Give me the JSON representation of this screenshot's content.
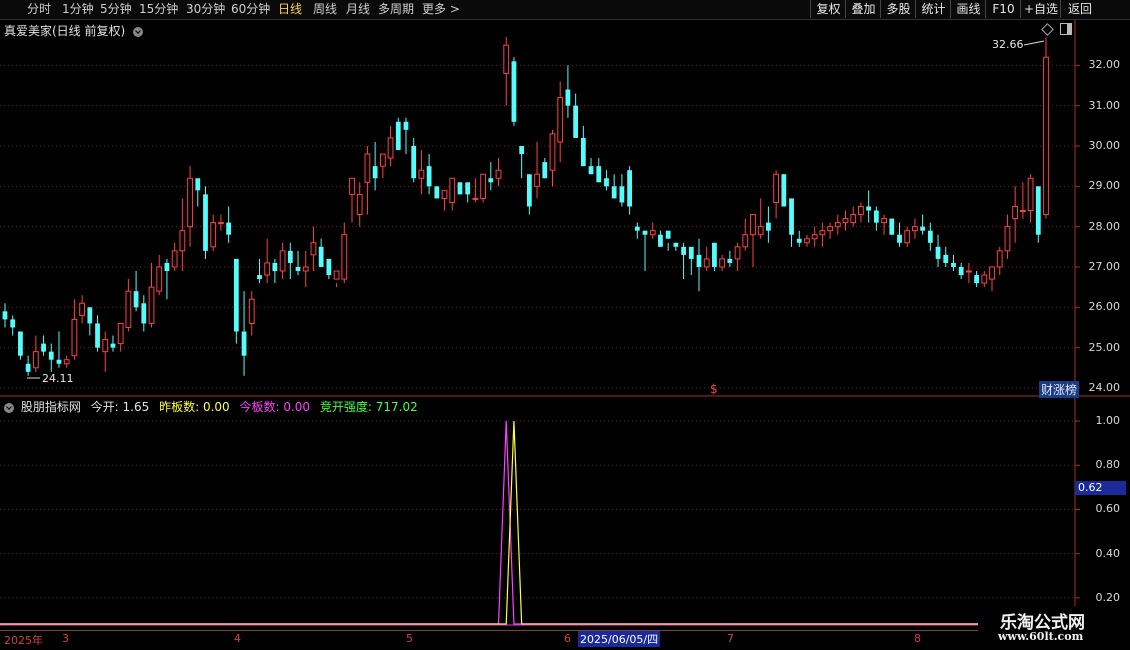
{
  "toolbar": {
    "periods": [
      "分时",
      "1分钟",
      "5分钟",
      "15分钟",
      "30分钟",
      "60分钟",
      "日线",
      "周线",
      "月线",
      "多周期",
      "更多 >"
    ],
    "active_period": "日线",
    "right_buttons": [
      "复权",
      "叠加",
      "多股",
      "统计",
      "画线",
      "F10",
      "+自选",
      "返回"
    ]
  },
  "main_panel": {
    "title": "真爱美家(日线 前复权)",
    "y_ticks": [
      "32.00",
      "31.00",
      "30.00",
      "29.00",
      "28.00",
      "27.00",
      "26.00",
      "25.00",
      "24.00"
    ],
    "high_label": "32.66",
    "low_label": "24.11",
    "board_label": "财涨榜",
    "dollar_marker": "$"
  },
  "indicator": {
    "name": "股朋指标网",
    "fields": [
      {
        "label": "今开: ",
        "value": "1.65"
      },
      {
        "label": "昨板数: ",
        "value": "0.00"
      },
      {
        "label": "今板数: ",
        "value": "0.00"
      },
      {
        "label": "竞开强度: ",
        "value": "717.02"
      }
    ],
    "y_ticks": [
      "1.00",
      "0.80",
      "0.60",
      "0.40",
      "0.20"
    ],
    "current_value": "0.62"
  },
  "date_axis": {
    "year_label": "2025年",
    "months": [
      "3",
      "4",
      "5",
      "6",
      "7",
      "8"
    ],
    "cursor_date": "2025/06/05/四"
  },
  "watermark": {
    "line1": "乐淘公式网",
    "line2": "www.60lt.com"
  },
  "colors": {
    "up": "#ff4040",
    "down": "#54fcfc",
    "background": "#000000",
    "yellow_line": "#ffff40",
    "magenta_line": "#ff40ff",
    "green_text": "#40ff40"
  },
  "chart_data": {
    "type": "candlestick",
    "y_range": [
      23.9,
      33.0
    ],
    "indicator_range": [
      0.1,
      1.05
    ],
    "ohlc": [
      [
        25.9,
        26.1,
        25.5,
        25.7
      ],
      [
        25.7,
        25.8,
        25.3,
        25.5
      ],
      [
        25.4,
        25.4,
        24.7,
        24.8
      ],
      [
        24.6,
        24.8,
        24.3,
        24.4
      ],
      [
        24.5,
        25.3,
        24.4,
        24.9
      ],
      [
        25.1,
        25.3,
        24.8,
        24.9
      ],
      [
        24.9,
        25.1,
        24.4,
        24.7
      ],
      [
        24.7,
        25.4,
        24.5,
        24.6
      ],
      [
        24.6,
        24.8,
        24.5,
        24.7
      ],
      [
        24.8,
        26.2,
        24.7,
        25.7
      ],
      [
        25.8,
        26.3,
        25.6,
        26.1
      ],
      [
        26.0,
        26.0,
        25.3,
        25.6
      ],
      [
        25.6,
        25.8,
        24.9,
        25.0
      ],
      [
        24.9,
        25.4,
        24.4,
        25.2
      ],
      [
        25.1,
        25.3,
        24.9,
        25.0
      ],
      [
        25.1,
        25.6,
        24.9,
        25.6
      ],
      [
        25.5,
        26.7,
        25.4,
        26.4
      ],
      [
        26.4,
        26.9,
        25.9,
        26.0
      ],
      [
        26.1,
        26.3,
        25.4,
        25.6
      ],
      [
        25.6,
        27.1,
        25.5,
        26.5
      ],
      [
        26.4,
        27.3,
        26.3,
        27.0
      ],
      [
        27.1,
        27.2,
        26.2,
        26.9
      ],
      [
        27.0,
        27.6,
        26.9,
        27.4
      ],
      [
        27.4,
        28.7,
        26.9,
        27.9
      ],
      [
        28.0,
        29.5,
        27.5,
        29.2
      ],
      [
        29.2,
        29.1,
        28.5,
        28.9
      ],
      [
        28.8,
        29.0,
        27.2,
        27.4
      ],
      [
        27.5,
        28.3,
        27.4,
        28.1
      ],
      [
        28.1,
        28.3,
        27.9,
        28.1
      ],
      [
        28.1,
        28.5,
        27.6,
        27.8
      ],
      [
        27.2,
        27.2,
        25.1,
        25.4
      ],
      [
        25.4,
        26.4,
        24.3,
        24.8
      ],
      [
        25.6,
        26.4,
        25.3,
        26.2
      ],
      [
        26.8,
        27.2,
        26.6,
        26.7
      ],
      [
        26.8,
        27.7,
        26.6,
        27.1
      ],
      [
        27.1,
        27.2,
        26.6,
        26.9
      ],
      [
        26.9,
        27.6,
        26.7,
        27.4
      ],
      [
        27.4,
        27.6,
        26.7,
        27.1
      ],
      [
        27.0,
        27.4,
        26.8,
        26.9
      ],
      [
        26.9,
        27.4,
        26.5,
        27.0
      ],
      [
        27.3,
        28.0,
        26.9,
        27.6
      ],
      [
        27.5,
        27.7,
        27.2,
        27.0
      ],
      [
        27.2,
        27.0,
        26.7,
        26.8
      ],
      [
        26.7,
        26.6,
        26.5,
        26.9
      ],
      [
        26.7,
        28.1,
        26.6,
        27.8
      ],
      [
        28.8,
        29.2,
        28.1,
        29.2
      ],
      [
        28.3,
        29.1,
        28.0,
        28.8
      ],
      [
        29.1,
        30.0,
        28.3,
        29.8
      ],
      [
        29.5,
        30.1,
        28.9,
        29.2
      ],
      [
        29.5,
        29.8,
        29.2,
        29.8
      ],
      [
        29.7,
        30.5,
        29.5,
        30.2
      ],
      [
        30.6,
        30.7,
        29.9,
        29.9
      ],
      [
        30.6,
        30.7,
        29.8,
        30.4
      ],
      [
        30.0,
        30.2,
        29.1,
        29.2
      ],
      [
        29.2,
        29.9,
        28.8,
        29.4
      ],
      [
        29.5,
        29.8,
        28.8,
        29.0
      ],
      [
        29.0,
        29.0,
        28.7,
        28.7
      ],
      [
        28.7,
        28.9,
        28.4,
        28.9
      ],
      [
        28.6,
        29.2,
        28.4,
        29.2
      ],
      [
        29.1,
        29.0,
        28.8,
        28.8
      ],
      [
        29.1,
        28.9,
        28.6,
        28.8
      ],
      [
        28.7,
        29.2,
        28.6,
        28.7
      ],
      [
        28.7,
        29.3,
        28.6,
        29.3
      ],
      [
        29.2,
        29.6,
        28.9,
        29.1
      ],
      [
        29.2,
        29.7,
        29.0,
        29.4
      ],
      [
        31.8,
        32.7,
        31.0,
        32.5
      ],
      [
        32.1,
        32.2,
        30.5,
        30.6
      ],
      [
        30.0,
        30.0,
        29.2,
        29.8
      ],
      [
        29.3,
        28.5,
        28.3,
        28.5
      ],
      [
        29.0,
        30.1,
        28.7,
        29.3
      ],
      [
        29.6,
        29.7,
        29.2,
        29.2
      ],
      [
        29.4,
        30.4,
        29.0,
        30.3
      ],
      [
        30.1,
        31.6,
        29.6,
        31.2
      ],
      [
        31.4,
        32.0,
        30.7,
        31.0
      ],
      [
        31.0,
        31.3,
        30.4,
        30.2
      ],
      [
        30.2,
        30.5,
        29.5,
        29.5
      ],
      [
        29.5,
        29.7,
        29.3,
        29.3
      ],
      [
        29.5,
        29.7,
        29.2,
        29.1
      ],
      [
        29.2,
        29.4,
        28.9,
        29.0
      ],
      [
        29.0,
        29.3,
        28.8,
        28.7
      ],
      [
        29.0,
        29.3,
        28.5,
        28.6
      ],
      [
        29.4,
        29.5,
        28.3,
        28.5
      ],
      [
        28.0,
        28.1,
        27.7,
        27.9
      ],
      [
        27.9,
        27.9,
        26.9,
        27.8
      ],
      [
        27.8,
        28.1,
        27.7,
        27.9
      ],
      [
        27.8,
        27.9,
        27.5,
        27.5
      ],
      [
        27.9,
        27.6,
        27.4,
        27.7
      ],
      [
        27.6,
        27.6,
        27.4,
        27.5
      ],
      [
        27.5,
        27.6,
        26.7,
        27.3
      ],
      [
        27.5,
        27.3,
        26.8,
        27.2
      ],
      [
        27.3,
        27.7,
        26.4,
        27.0
      ],
      [
        27.0,
        27.5,
        26.9,
        27.2
      ],
      [
        27.6,
        27.6,
        26.9,
        27.0
      ],
      [
        27.0,
        27.3,
        26.9,
        27.2
      ],
      [
        27.2,
        27.4,
        27.0,
        27.1
      ],
      [
        27.2,
        27.6,
        26.9,
        27.5
      ],
      [
        27.5,
        28.2,
        27.4,
        27.8
      ],
      [
        27.8,
        28.2,
        27.0,
        28.3
      ],
      [
        27.8,
        28.7,
        27.7,
        28.0
      ],
      [
        28.1,
        28.5,
        27.6,
        27.9
      ],
      [
        28.6,
        29.4,
        28.2,
        29.3
      ],
      [
        29.3,
        29.3,
        28.5,
        28.5
      ],
      [
        28.7,
        28.7,
        27.5,
        27.8
      ],
      [
        27.7,
        27.9,
        27.5,
        27.6
      ],
      [
        27.6,
        27.8,
        27.5,
        27.7
      ],
      [
        27.7,
        28.0,
        27.5,
        27.8
      ],
      [
        27.8,
        28.1,
        27.5,
        27.9
      ],
      [
        27.9,
        28.1,
        27.7,
        28.0
      ],
      [
        28.0,
        28.3,
        27.8,
        28.1
      ],
      [
        28.1,
        28.4,
        27.9,
        28.2
      ],
      [
        28.1,
        28.5,
        28.0,
        28.3
      ],
      [
        28.3,
        28.6,
        28.1,
        28.5
      ],
      [
        28.5,
        28.9,
        28.1,
        28.4
      ],
      [
        28.4,
        28.5,
        27.9,
        28.1
      ],
      [
        28.1,
        28.3,
        27.8,
        28.2
      ],
      [
        28.2,
        28.2,
        27.8,
        27.8
      ],
      [
        27.8,
        28.1,
        27.5,
        27.6
      ],
      [
        27.6,
        28.0,
        27.5,
        27.9
      ],
      [
        27.9,
        28.2,
        27.7,
        28.0
      ],
      [
        28.0,
        28.3,
        27.8,
        27.9
      ],
      [
        27.9,
        28.1,
        27.4,
        27.6
      ],
      [
        27.5,
        27.8,
        27.0,
        27.2
      ],
      [
        27.3,
        27.5,
        27.0,
        27.1
      ],
      [
        27.1,
        27.3,
        26.9,
        27.0
      ],
      [
        27.0,
        27.1,
        26.7,
        26.8
      ],
      [
        26.9,
        27.1,
        26.6,
        26.9
      ],
      [
        26.8,
        26.9,
        26.5,
        26.6
      ],
      [
        26.6,
        26.9,
        26.5,
        26.8
      ],
      [
        26.7,
        27.0,
        26.4,
        27.0
      ],
      [
        27.0,
        27.5,
        26.8,
        27.4
      ],
      [
        27.4,
        28.3,
        27.2,
        28.0
      ],
      [
        28.2,
        29.0,
        27.6,
        28.5
      ],
      [
        28.4,
        29.1,
        28.2,
        28.4
      ],
      [
        28.4,
        29.3,
        28.1,
        29.2
      ],
      [
        29.0,
        29.0,
        27.6,
        27.8
      ],
      [
        28.3,
        32.7,
        28.2,
        32.2
      ]
    ],
    "indicator_yellow_spike_index": 66,
    "indicator_magenta_spike_index": 65
  }
}
